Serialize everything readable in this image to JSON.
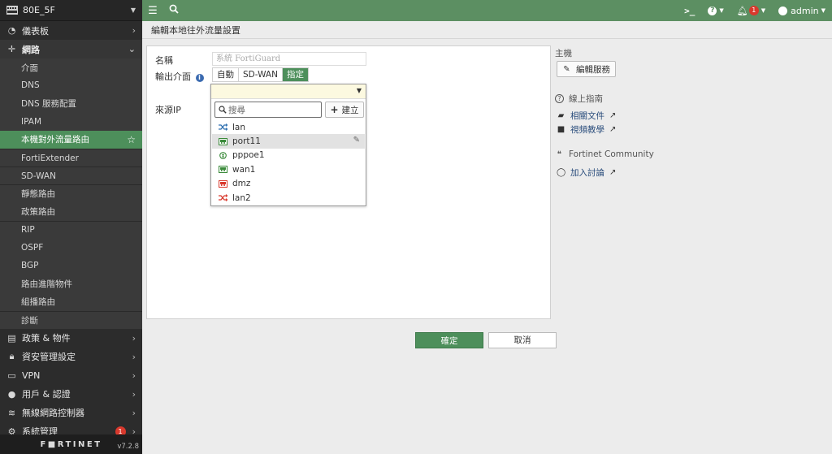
{
  "device": {
    "name": "80E_5F"
  },
  "sidebar": {
    "top_items": [
      {
        "label": "儀表板",
        "icon": "dashboard-icon"
      },
      {
        "label": "網路",
        "icon": "network-icon"
      }
    ],
    "network_sub": [
      "介面",
      "DNS",
      "DNS 服務配置",
      "IPAM",
      "本機對外流量路由",
      "FortiExtender",
      "SD-WAN",
      "靜態路由",
      "政策路由",
      "RIP",
      "OSPF",
      "BGP",
      "路由進階物件",
      "組播路由",
      "診斷"
    ],
    "bottom_items": [
      {
        "label": "政策 & 物件",
        "icon": "policy-icon"
      },
      {
        "label": "資安管理設定",
        "icon": "lock-icon"
      },
      {
        "label": "VPN",
        "icon": "monitor-icon"
      },
      {
        "label": "用戶 & 認證",
        "icon": "user-icon"
      },
      {
        "label": "無線網路控制器",
        "icon": "wifi-icon"
      },
      {
        "label": "系統管理",
        "icon": "gear-icon",
        "badge": "1"
      }
    ],
    "footer": {
      "logo": "F■RTINET",
      "version": "v7.2.8"
    }
  },
  "topbar": {
    "alert_count": "1",
    "user": "admin"
  },
  "page_title": "編輯本地往外流量設置",
  "form": {
    "name_label": "名稱",
    "name_placeholder": "系統 FortiGuard",
    "outgoing_label": "輸出介面",
    "segments": [
      "自動",
      "SD-WAN",
      "指定"
    ],
    "selected_segment": "指定",
    "source_ip_label": "來源IP"
  },
  "dropdown": {
    "search_placeholder": "搜尋",
    "create_label": "建立",
    "items": [
      {
        "name": "lan",
        "icon": "shuffle-icon",
        "color": "#2e6fb0"
      },
      {
        "name": "port11",
        "icon": "port-icon",
        "color": "#3a8a3a",
        "hover": true
      },
      {
        "name": "pppoe1",
        "icon": "pppoe-icon",
        "color": "#3a8a3a"
      },
      {
        "name": "wan1",
        "icon": "port-icon",
        "color": "#3a8a3a"
      },
      {
        "name": "dmz",
        "icon": "port-icon",
        "color": "#d9392d"
      },
      {
        "name": "lan2",
        "icon": "shuffle-icon",
        "color": "#d9392d"
      }
    ]
  },
  "buttons": {
    "ok": "確定",
    "cancel": "取消"
  },
  "right_panel": {
    "host_heading": "主機",
    "edit_service": "編輯服務",
    "guide_heading": "線上指南",
    "docs_link": "相關文件",
    "video_link": "視頻教學",
    "community_heading": "Fortinet Community",
    "discussion_link": "加入討論"
  }
}
